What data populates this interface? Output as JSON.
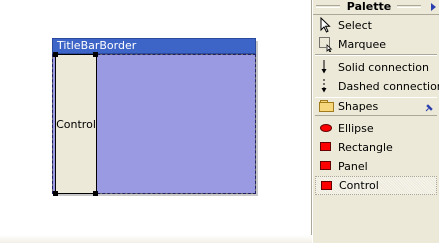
{
  "canvas": {
    "figure": {
      "title": "TitleBarBorder",
      "control_label": "Control"
    }
  },
  "palette": {
    "title": "Palette",
    "tools": {
      "select": "Select",
      "marquee": "Marquee",
      "solid_connection": "Solid connection",
      "dashed_connection": "Dashed connection"
    },
    "drawer": {
      "label": "Shapes",
      "items": {
        "ellipse": "Ellipse",
        "rectangle": "Rectangle",
        "panel": "Panel",
        "control": "Control"
      }
    }
  },
  "colors": {
    "title_bar": "#3d64c7",
    "figure_body": "#9a9ae3",
    "shape_icon": "#ff0000",
    "palette_bg": "#ece9d8"
  }
}
